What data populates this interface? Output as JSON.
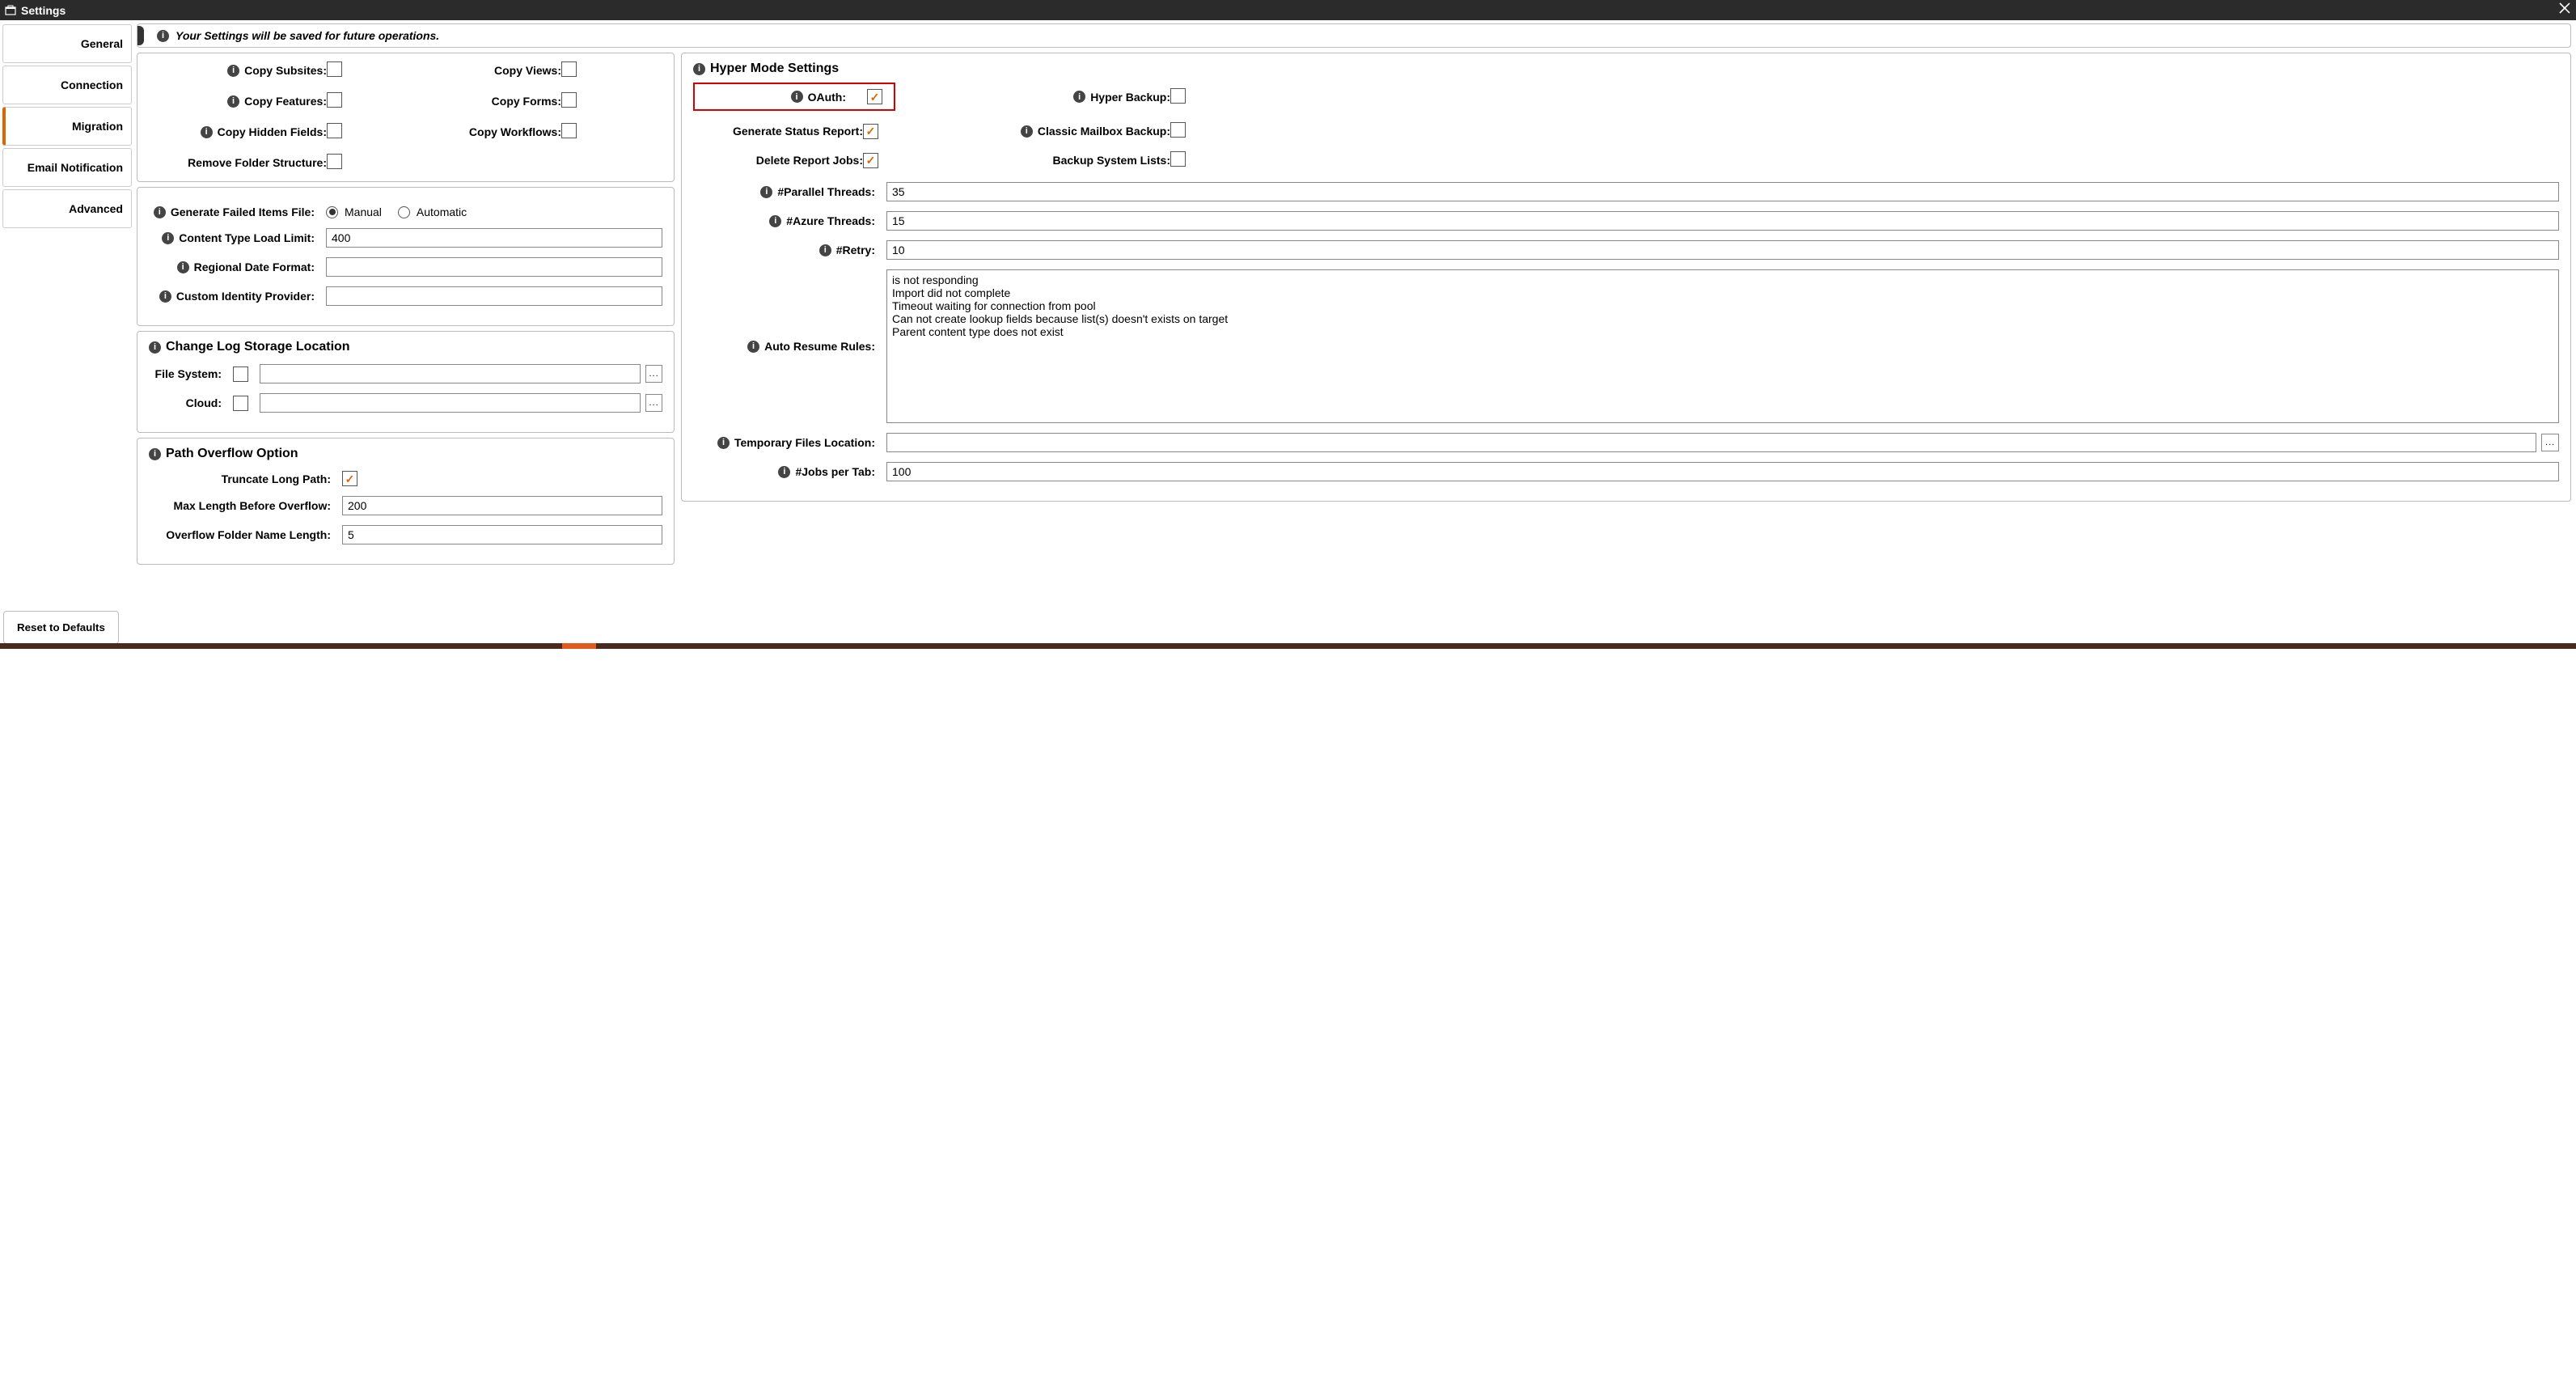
{
  "title": "Settings",
  "info_message": "Your Settings will be saved for future operations.",
  "sidebar": {
    "items": [
      {
        "label": "General"
      },
      {
        "label": "Connection"
      },
      {
        "label": "Migration"
      },
      {
        "label": "Email Notification"
      },
      {
        "label": "Advanced"
      }
    ],
    "reset_label": "Reset to Defaults"
  },
  "copy_options": {
    "copy_subsites": "Copy Subsites:",
    "copy_views": "Copy Views:",
    "copy_features": "Copy Features:",
    "copy_forms": "Copy Forms:",
    "copy_hidden_fields": "Copy Hidden Fields:",
    "copy_workflows": "Copy Workflows:",
    "remove_folder_structure": "Remove Folder Structure:"
  },
  "failed_items": {
    "generate_label": "Generate Failed Items File:",
    "manual_label": "Manual",
    "automatic_label": "Automatic",
    "content_type_limit_label": "Content Type Load Limit:",
    "content_type_limit_value": "400",
    "regional_date_label": "Regional Date Format:",
    "regional_date_value": "",
    "custom_idp_label": "Custom Identity Provider:",
    "custom_idp_value": ""
  },
  "change_log": {
    "title": "Change Log Storage Location",
    "file_system_label": "File System:",
    "file_system_value": "",
    "cloud_label": "Cloud:",
    "cloud_value": ""
  },
  "path_overflow": {
    "title": "Path Overflow Option",
    "truncate_label": "Truncate Long Path:",
    "max_length_label": "Max Length Before Overflow:",
    "max_length_value": "200",
    "folder_name_length_label": "Overflow Folder Name Length:",
    "folder_name_length_value": "5"
  },
  "hyper": {
    "title": "Hyper Mode Settings",
    "oauth_label": "OAuth:",
    "hyper_backup_label": "Hyper Backup:",
    "generate_status_label": "Generate Status Report:",
    "classic_mailbox_label": "Classic Mailbox Backup:",
    "delete_report_label": "Delete Report Jobs:",
    "backup_system_lists_label": "Backup System Lists:",
    "parallel_threads_label": "#Parallel Threads:",
    "parallel_threads_value": "35",
    "azure_threads_label": "#Azure Threads:",
    "azure_threads_value": "15",
    "retry_label": "#Retry:",
    "retry_value": "10",
    "auto_resume_label": "Auto Resume Rules:",
    "auto_resume_value": "is not responding\nImport did not complete\nTimeout waiting for connection from pool\nCan not create lookup fields because list(s) doesn't exists on target\nParent content type does not exist",
    "temp_files_label": "Temporary Files Location:",
    "temp_files_value": "",
    "jobs_per_tab_label": "#Jobs per Tab:",
    "jobs_per_tab_value": "100"
  },
  "browse_label": "..."
}
